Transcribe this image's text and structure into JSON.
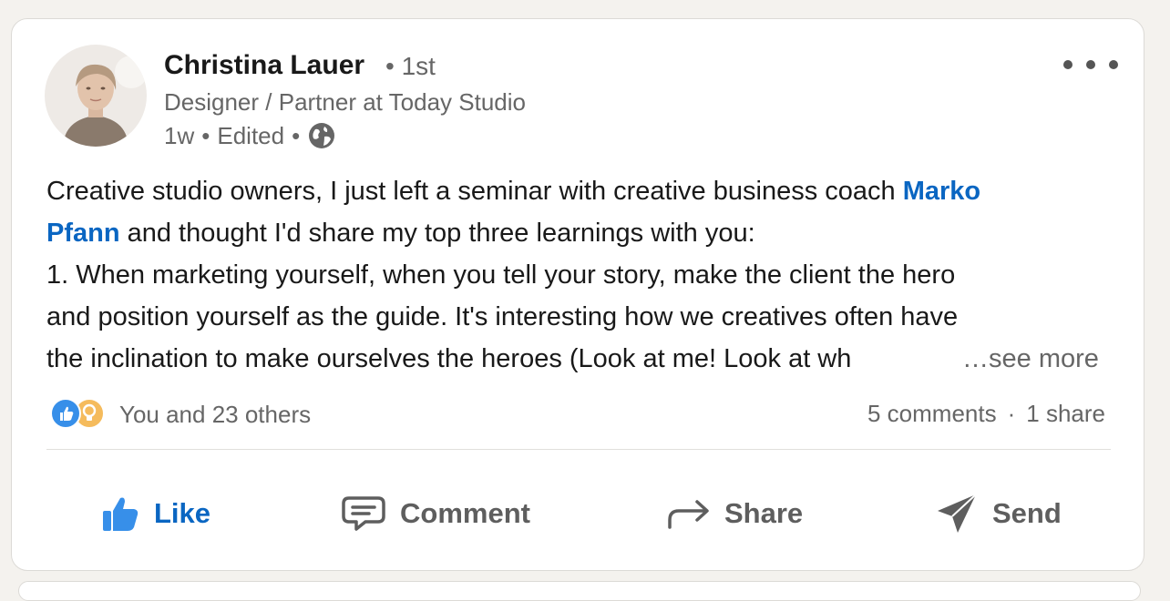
{
  "colors": {
    "accent": "#0a66c2",
    "muted": "#666666",
    "text": "#191919",
    "background": "#f4f2ee",
    "card": "#ffffff"
  },
  "post": {
    "author": {
      "name": "Christina Lauer",
      "degree": "• 1st",
      "headline": "Designer / Partner at Today Studio",
      "age": "1w",
      "edited": "Edited",
      "visibility_icon": "globe-icon"
    },
    "body": {
      "line1_prefix": "Creative studio owners, I just left a seminar with creative business coach ",
      "mention_first": "Marko",
      "mention_last": "Pfann",
      "line2_suffix": " and thought I'd share my top three learnings with you:",
      "line3": "1. When marketing yourself, when you tell your story, make the client the hero",
      "line4": "and position yourself as the guide. It's interesting how we creatives often have",
      "line5": "the inclination to make ourselves the heroes (Look at me! Look at wh",
      "see_more": "…see more"
    },
    "social": {
      "reactions_label": "You and 23 others",
      "reaction_icons": [
        "like-reaction-icon",
        "insightful-reaction-icon"
      ],
      "comments": "5 comments",
      "shares": "1 share"
    },
    "actions": {
      "like": "Like",
      "comment": "Comment",
      "share": "Share",
      "send": "Send"
    }
  }
}
